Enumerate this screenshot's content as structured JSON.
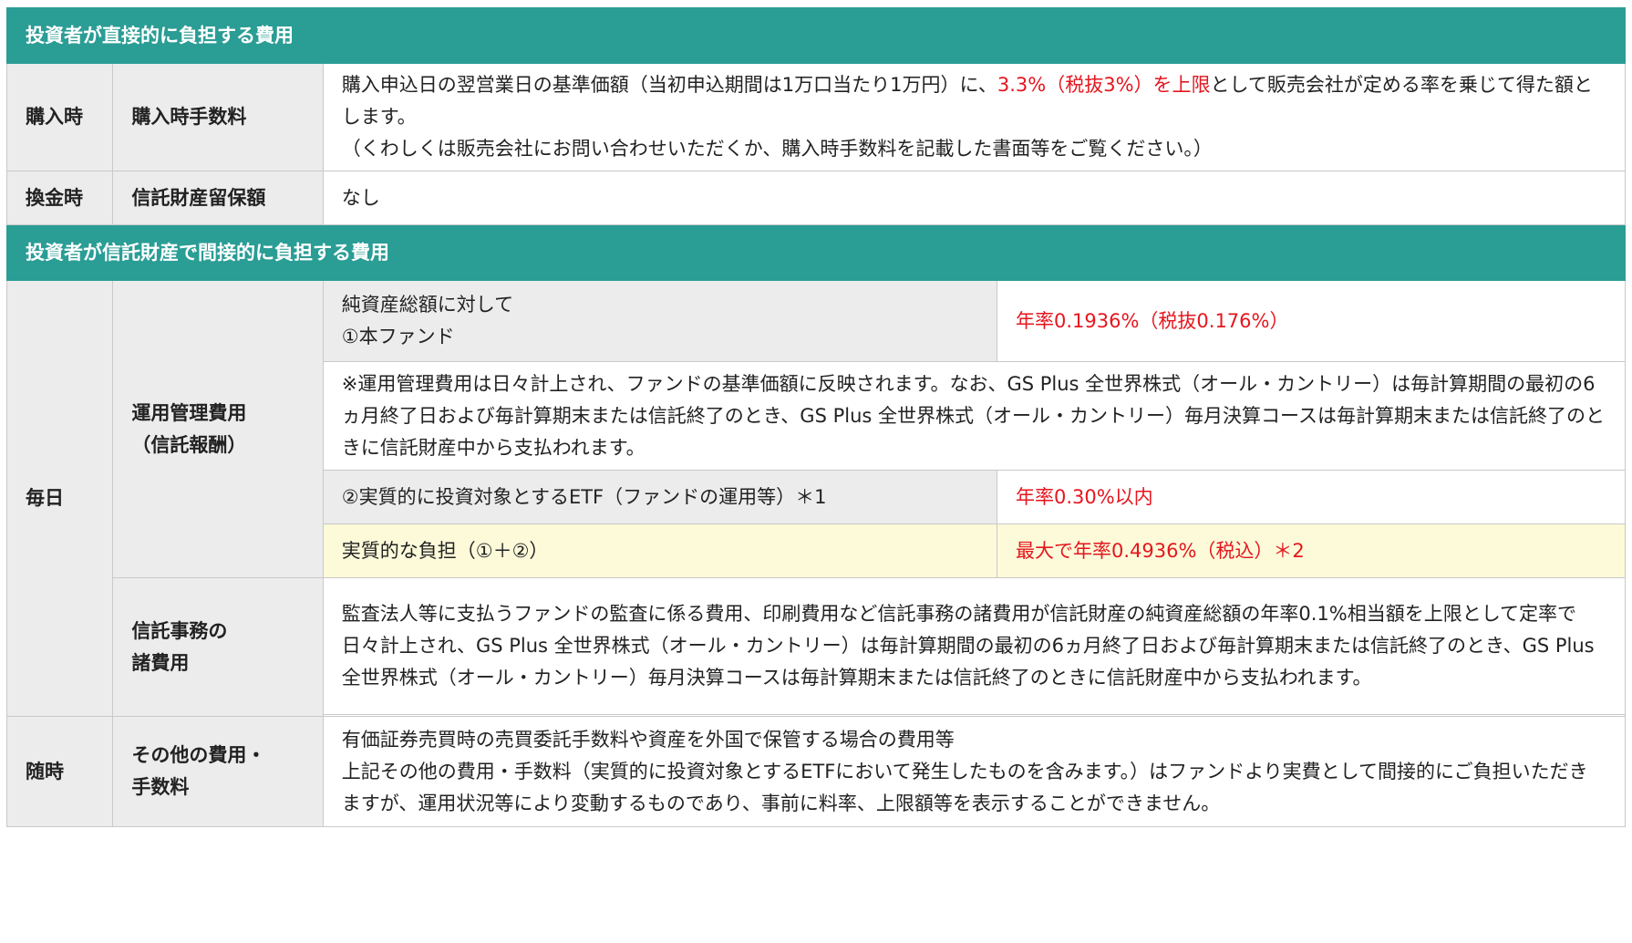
{
  "sections": {
    "direct": {
      "title": "投資者が直接的に負担する費用"
    },
    "indirect": {
      "title": "投資者が信託財産で間接的に負担する費用"
    }
  },
  "purchase": {
    "timing": "購入時",
    "item": "購入時手数料",
    "desc_part1": "購入申込日の翌営業日の基準価額（当初申込期間は1万口当たり1万円）に、",
    "desc_highlight": "3.3%（税抜3%）を上限",
    "desc_part2": "として販売会社が定める率を乗じて得た額とします。",
    "desc_note": "（くわしくは販売会社にお問い合わせいただくか、購入時手数料を記載した書面等をご覧ください。）"
  },
  "redemption": {
    "timing": "換金時",
    "item": "信託財産留保額",
    "value": "なし"
  },
  "daily": {
    "timing": "毎日",
    "mgmt": {
      "item_line1": "運用管理費用",
      "item_line2": "（信託報酬）",
      "fund_label_line1": "純資産総額に対して",
      "fund_label_line2": "①本ファンド",
      "fund_rate": "年率0.1936%（税抜0.176%）",
      "note": "※運用管理費用は日々計上され、ファンドの基準価額に反映されます。なお、GS Plus 全世界株式（オール・カントリー）は毎計算期間の最初の6ヵ月終了日および毎計算期末または信託終了のとき、GS Plus 全世界株式（オール・カントリー）毎月決算コースは毎計算期末または信託終了のときに信託財産中から支払われます。",
      "etf_label": "②実質的に投資対象とするETF（ファンドの運用等）＊1",
      "etf_rate": "年率0.30%以内",
      "total_label": "実質的な負担（①＋②）",
      "total_rate": "最大で年率0.4936%（税込）＊2"
    },
    "trust": {
      "item_line1": "信託事務の",
      "item_line2": "諸費用",
      "desc": "監査法人等に支払うファンドの監査に係る費用、印刷費用など信託事務の諸費用が信託財産の純資産総額の年率0.1%相当額を上限として定率で日々計上され、GS Plus 全世界株式（オール・カントリー）は毎計算期間の最初の6ヵ月終了日および毎計算期末または信託終了のとき、GS Plus 全世界株式（オール・カントリー）毎月決算コースは毎計算期末または信託終了のときに信託財産中から支払われます。"
    }
  },
  "anytime": {
    "timing": "随時",
    "item_line1": "その他の費用・",
    "item_line2": "手数料",
    "desc_line1": "有価証券売買時の売買委託手数料や資産を外国で保管する場合の費用等",
    "desc_line2": "上記その他の費用・手数料（実質的に投資対象とするETFにおいて発生したものを含みます。）はファンドより実費として間接的にご負担いただきますが、運用状況等により変動するものであり、事前に料率、上限額等を表示することができません。"
  },
  "colors": {
    "header_teal": "#2a9d95",
    "label_grey": "#ececec",
    "highlight_red": "#e5161e",
    "total_yellow": "#fcfad9"
  }
}
